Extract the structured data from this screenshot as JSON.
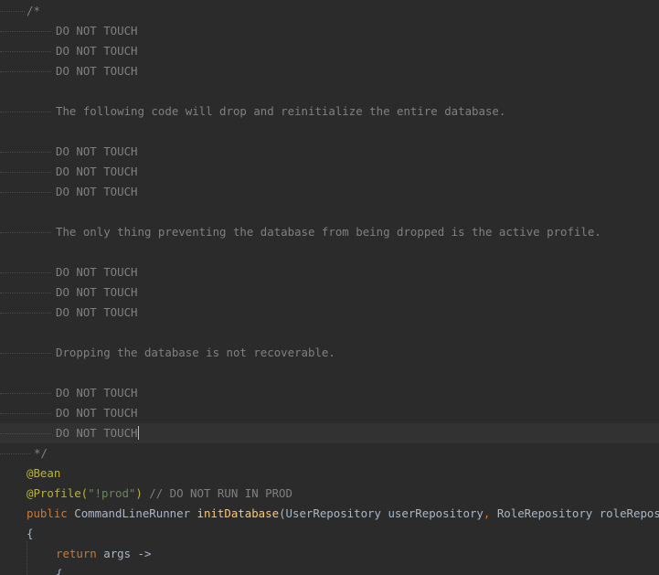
{
  "editor": {
    "comment_lines": [
      "/*",
      "DO NOT TOUCH",
      "DO NOT TOUCH",
      "DO NOT TOUCH",
      "",
      "The following code will drop and reinitialize the entire database.",
      "",
      "DO NOT TOUCH",
      "DO NOT TOUCH",
      "DO NOT TOUCH",
      "",
      "The only thing preventing the database from being dropped is the active profile.",
      "",
      "DO NOT TOUCH",
      "DO NOT TOUCH",
      "DO NOT TOUCH",
      "",
      "Dropping the database is not recoverable.",
      "",
      "DO NOT TOUCH",
      "DO NOT TOUCH",
      "DO NOT TOUCH",
      "*/"
    ],
    "bean_annotation": "@Bean",
    "profile_annotation": "@Profile(",
    "profile_value": "\"!prod\"",
    "profile_close": ")",
    "profile_comment": "// DO NOT RUN IN PROD",
    "method_keyword_public": "public",
    "method_return_type": "CommandLineRunner",
    "method_name": "initDatabase",
    "method_paren_open": "(",
    "param1_type": "UserRepository",
    "param1_name": "userRepository",
    "param_comma": ",",
    "param2_type": "RoleRepository",
    "param2_name": "roleRepository",
    "open_brace": "{",
    "return_keyword": "return",
    "return_expr": "args ->",
    "inner_brace": "{"
  },
  "colors": {
    "background": "#2b2b2b",
    "current_line": "#323232",
    "comment": "#808080",
    "annotation": "#bbb529",
    "string": "#6a8759",
    "keyword": "#cc7832",
    "method": "#ffc66d",
    "text": "#a9b7c6"
  }
}
